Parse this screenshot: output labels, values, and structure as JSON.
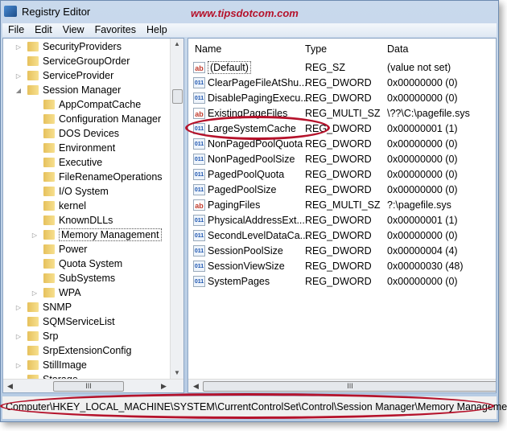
{
  "window": {
    "title": "Registry Editor",
    "watermark": "www.tipsdotcom.com"
  },
  "menu": [
    "File",
    "Edit",
    "View",
    "Favorites",
    "Help"
  ],
  "tree": [
    {
      "label": "SecurityProviders",
      "level": 1,
      "exp": "▷"
    },
    {
      "label": "ServiceGroupOrder",
      "level": 1,
      "exp": ""
    },
    {
      "label": "ServiceProvider",
      "level": 1,
      "exp": "▷"
    },
    {
      "label": "Session Manager",
      "level": 1,
      "exp": "◢"
    },
    {
      "label": "AppCompatCache",
      "level": 2,
      "exp": ""
    },
    {
      "label": "Configuration Manager",
      "level": 2,
      "exp": ""
    },
    {
      "label": "DOS Devices",
      "level": 2,
      "exp": ""
    },
    {
      "label": "Environment",
      "level": 2,
      "exp": ""
    },
    {
      "label": "Executive",
      "level": 2,
      "exp": ""
    },
    {
      "label": "FileRenameOperations",
      "level": 2,
      "exp": ""
    },
    {
      "label": "I/O System",
      "level": 2,
      "exp": ""
    },
    {
      "label": "kernel",
      "level": 2,
      "exp": ""
    },
    {
      "label": "KnownDLLs",
      "level": 2,
      "exp": ""
    },
    {
      "label": "Memory Management",
      "level": 2,
      "exp": "▷",
      "selected": true
    },
    {
      "label": "Power",
      "level": 2,
      "exp": ""
    },
    {
      "label": "Quota System",
      "level": 2,
      "exp": ""
    },
    {
      "label": "SubSystems",
      "level": 2,
      "exp": ""
    },
    {
      "label": "WPA",
      "level": 2,
      "exp": "▷"
    },
    {
      "label": "SNMP",
      "level": 1,
      "exp": "▷"
    },
    {
      "label": "SQMServiceList",
      "level": 1,
      "exp": ""
    },
    {
      "label": "Srp",
      "level": 1,
      "exp": "▷"
    },
    {
      "label": "SrpExtensionConfig",
      "level": 1,
      "exp": ""
    },
    {
      "label": "StillImage",
      "level": 1,
      "exp": "▷"
    },
    {
      "label": "Storage",
      "level": 1,
      "exp": ""
    }
  ],
  "list": {
    "columns": [
      "Name",
      "Type",
      "Data"
    ],
    "rows": [
      {
        "icon": "string",
        "name": "(Default)",
        "type": "REG_SZ",
        "data": "(value not set)"
      },
      {
        "icon": "dword",
        "name": "ClearPageFileAtShu...",
        "type": "REG_DWORD",
        "data": "0x00000000 (0)"
      },
      {
        "icon": "dword",
        "name": "DisablePagingExecu...",
        "type": "REG_DWORD",
        "data": "0x00000000 (0)"
      },
      {
        "icon": "string",
        "name": "ExistingPageFiles",
        "type": "REG_MULTI_SZ",
        "data": "\\??\\C:\\pagefile.sys"
      },
      {
        "icon": "dword",
        "name": "LargeSystemCache",
        "type": "REG_DWORD",
        "data": "0x00000001 (1)",
        "highlighted": true
      },
      {
        "icon": "dword",
        "name": "NonPagedPoolQuota",
        "type": "REG_DWORD",
        "data": "0x00000000 (0)"
      },
      {
        "icon": "dword",
        "name": "NonPagedPoolSize",
        "type": "REG_DWORD",
        "data": "0x00000000 (0)"
      },
      {
        "icon": "dword",
        "name": "PagedPoolQuota",
        "type": "REG_DWORD",
        "data": "0x00000000 (0)"
      },
      {
        "icon": "dword",
        "name": "PagedPoolSize",
        "type": "REG_DWORD",
        "data": "0x00000000 (0)"
      },
      {
        "icon": "string",
        "name": "PagingFiles",
        "type": "REG_MULTI_SZ",
        "data": "?:\\pagefile.sys"
      },
      {
        "icon": "dword",
        "name": "PhysicalAddressExt...",
        "type": "REG_DWORD",
        "data": "0x00000001 (1)"
      },
      {
        "icon": "dword",
        "name": "SecondLevelDataCa...",
        "type": "REG_DWORD",
        "data": "0x00000000 (0)"
      },
      {
        "icon": "dword",
        "name": "SessionPoolSize",
        "type": "REG_DWORD",
        "data": "0x00000004 (4)"
      },
      {
        "icon": "dword",
        "name": "SessionViewSize",
        "type": "REG_DWORD",
        "data": "0x00000030 (48)"
      },
      {
        "icon": "dword",
        "name": "SystemPages",
        "type": "REG_DWORD",
        "data": "0x00000000 (0)"
      }
    ]
  },
  "status": {
    "path": "Computer\\HKEY_LOCAL_MACHINE\\SYSTEM\\CurrentControlSet\\Control\\Session Manager\\Memory Management"
  },
  "colors": {
    "highlight_ring": "#b5122b",
    "watermark": "#b5122b"
  }
}
